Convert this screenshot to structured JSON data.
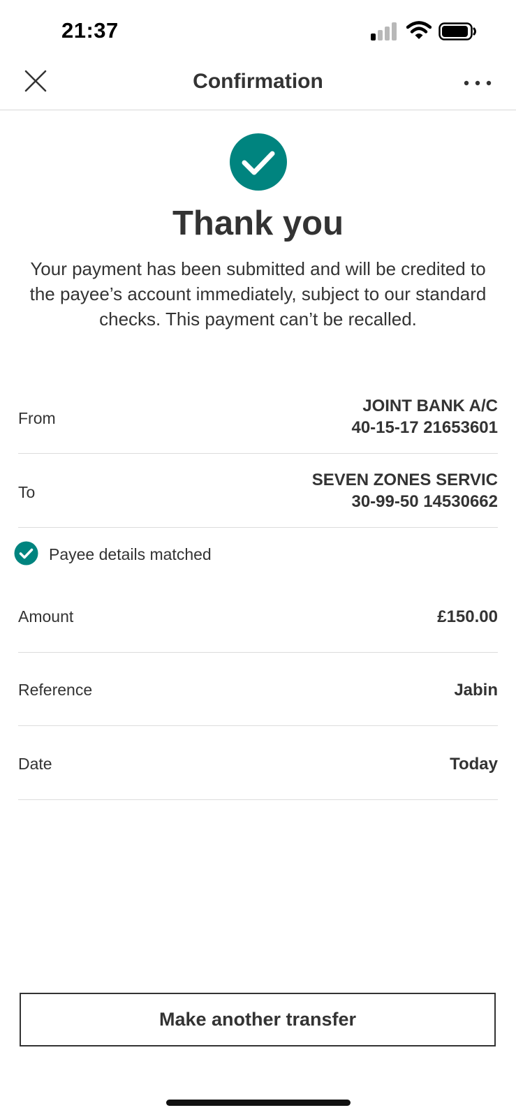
{
  "status_bar": {
    "time": "21:37",
    "icons": [
      "signal-icon",
      "wifi-icon",
      "battery-icon"
    ]
  },
  "nav": {
    "title": "Confirmation",
    "close_icon": "close-icon",
    "more_icon": "more-options-icon"
  },
  "success": {
    "icon": "check-circle-icon",
    "headline": "Thank you",
    "message": "Your payment has been submitted and will be credited to the payee’s account immediately, subject to our standard checks. This payment can’t be recalled."
  },
  "details": {
    "from": {
      "label": "From",
      "name": "JOINT BANK A/C",
      "account": "40-15-17 21653601"
    },
    "to": {
      "label": "To",
      "name": "SEVEN ZONES SERVIC",
      "account": "30-99-50 14530662"
    },
    "payee_match": {
      "icon": "check-circle-icon",
      "text": "Payee details matched"
    },
    "amount": {
      "label": "Amount",
      "value": "£150.00"
    },
    "reference": {
      "label": "Reference",
      "value": "Jabin"
    },
    "date": {
      "label": "Date",
      "value": "Today"
    }
  },
  "actions": {
    "make_another_transfer": "Make another transfer"
  },
  "colors": {
    "accent": "#00847f",
    "text": "#333333",
    "divider": "#dcdcdc"
  }
}
